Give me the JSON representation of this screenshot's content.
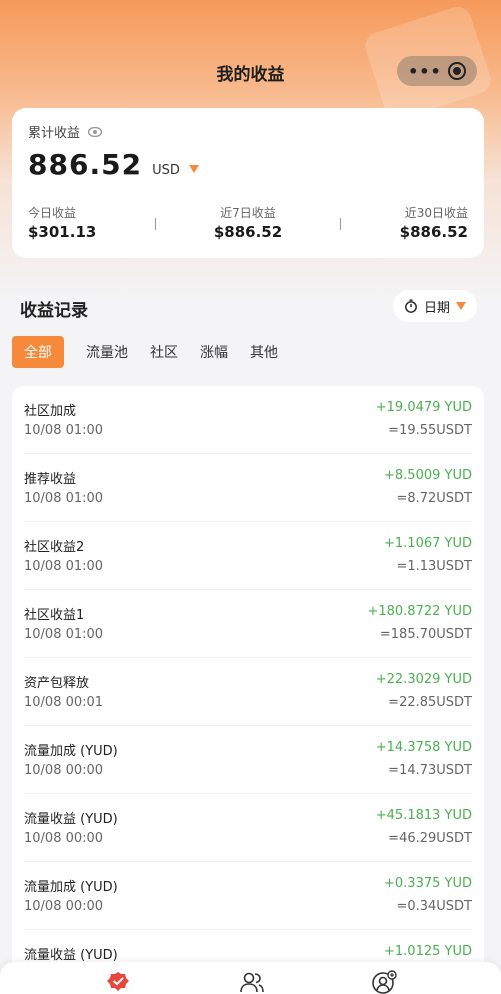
{
  "header": {
    "title": "我的收益"
  },
  "summary": {
    "label": "累计收益",
    "amount": "886.52",
    "currency": "USD",
    "stats": [
      {
        "label": "今日收益",
        "value": "$301.13"
      },
      {
        "label": "近7日收益",
        "value": "$886.52"
      },
      {
        "label": "近30日收益",
        "value": "$886.52"
      }
    ]
  },
  "records": {
    "title": "收益记录",
    "date_filter_label": "日期",
    "tabs": [
      "全部",
      "流量池",
      "社区",
      "涨幅",
      "其他"
    ],
    "items": [
      {
        "name": "社区加成",
        "time": "10/08 01:00",
        "amount": "+19.0479 YUD",
        "usdt": "=19.55USDT"
      },
      {
        "name": "推荐收益",
        "time": "10/08 01:00",
        "amount": "+8.5009 YUD",
        "usdt": "=8.72USDT"
      },
      {
        "name": "社区收益2",
        "time": "10/08 01:00",
        "amount": "+1.1067 YUD",
        "usdt": "=1.13USDT"
      },
      {
        "name": "社区收益1",
        "time": "10/08 01:00",
        "amount": "+180.8722 YUD",
        "usdt": "=185.70USDT"
      },
      {
        "name": "资产包释放",
        "time": "10/08 00:01",
        "amount": "+22.3029 YUD",
        "usdt": "=22.85USDT"
      },
      {
        "name": "流量加成 (YUD)",
        "time": "10/08 00:00",
        "amount": "+14.3758 YUD",
        "usdt": "=14.73USDT"
      },
      {
        "name": "流量收益 (YUD)",
        "time": "10/08 00:00",
        "amount": "+45.1813 YUD",
        "usdt": "=46.29USDT"
      },
      {
        "name": "流量加成 (YUD)",
        "time": "10/08 00:00",
        "amount": "+0.3375 YUD",
        "usdt": "=0.34USDT"
      },
      {
        "name": "流量收益 (YUD)",
        "time": "",
        "amount": "+1.0125 YUD",
        "usdt": ""
      }
    ]
  },
  "colors": {
    "accent": "#f7893a",
    "positive": "#4caf50",
    "nav_active": "#e8453c"
  },
  "icons": [
    "eye-icon",
    "caret-down-icon",
    "timer-icon",
    "more-icon",
    "target-icon",
    "earnings-icon",
    "community-icon",
    "profile-icon"
  ]
}
